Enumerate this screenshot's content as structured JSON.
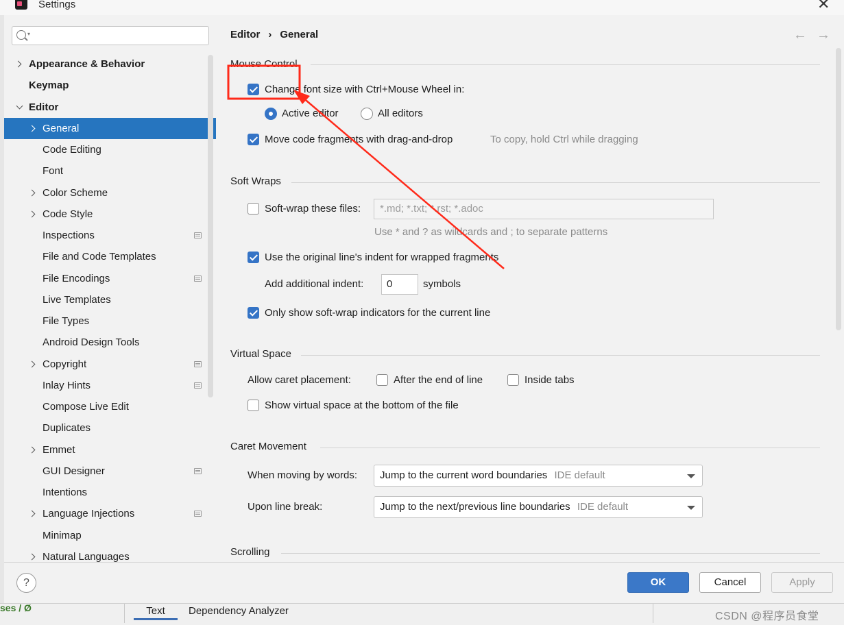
{
  "window": {
    "title": "Settings",
    "close_glyph": "✕"
  },
  "search": {
    "placeholder": ""
  },
  "sidebar": {
    "items": [
      {
        "label": "Appearance & Behavior",
        "bold": true,
        "expander": "right",
        "level": 0
      },
      {
        "label": "Keymap",
        "bold": true,
        "expander": "none",
        "level": 0
      },
      {
        "label": "Editor",
        "bold": true,
        "expander": "down",
        "level": 0
      },
      {
        "label": "General",
        "bold": false,
        "expander": "right",
        "level": 1,
        "selected": true
      },
      {
        "label": "Code Editing",
        "bold": false,
        "expander": "none",
        "level": 1
      },
      {
        "label": "Font",
        "bold": false,
        "expander": "none",
        "level": 1
      },
      {
        "label": "Color Scheme",
        "bold": false,
        "expander": "right",
        "level": 1
      },
      {
        "label": "Code Style",
        "bold": false,
        "expander": "right",
        "level": 1
      },
      {
        "label": "Inspections",
        "bold": false,
        "expander": "none",
        "level": 1,
        "project_icon": true
      },
      {
        "label": "File and Code Templates",
        "bold": false,
        "expander": "none",
        "level": 1
      },
      {
        "label": "File Encodings",
        "bold": false,
        "expander": "none",
        "level": 1,
        "project_icon": true
      },
      {
        "label": "Live Templates",
        "bold": false,
        "expander": "none",
        "level": 1
      },
      {
        "label": "File Types",
        "bold": false,
        "expander": "none",
        "level": 1
      },
      {
        "label": "Android Design Tools",
        "bold": false,
        "expander": "none",
        "level": 1
      },
      {
        "label": "Copyright",
        "bold": false,
        "expander": "right",
        "level": 1,
        "project_icon": true
      },
      {
        "label": "Inlay Hints",
        "bold": false,
        "expander": "none",
        "level": 1,
        "project_icon": true
      },
      {
        "label": "Compose Live Edit",
        "bold": false,
        "expander": "none",
        "level": 1
      },
      {
        "label": "Duplicates",
        "bold": false,
        "expander": "none",
        "level": 1
      },
      {
        "label": "Emmet",
        "bold": false,
        "expander": "right",
        "level": 1
      },
      {
        "label": "GUI Designer",
        "bold": false,
        "expander": "none",
        "level": 1,
        "project_icon": true
      },
      {
        "label": "Intentions",
        "bold": false,
        "expander": "none",
        "level": 1
      },
      {
        "label": "Language Injections",
        "bold": false,
        "expander": "right",
        "level": 1,
        "project_icon": true
      },
      {
        "label": "Minimap",
        "bold": false,
        "expander": "none",
        "level": 1
      },
      {
        "label": "Natural Languages",
        "bold": false,
        "expander": "right",
        "level": 1
      }
    ]
  },
  "breadcrumb": {
    "parent": "Editor",
    "separator": "›",
    "current": "General"
  },
  "nav": {
    "back": "←",
    "forward": "→"
  },
  "mouse_control": {
    "title": "Mouse Control",
    "change_font_size": {
      "label": "Change font size with Ctrl+Mouse Wheel in:",
      "checked": true
    },
    "active_editor": {
      "label": "Active editor",
      "selected": true
    },
    "all_editors": {
      "label": "All editors",
      "selected": false
    },
    "move_fragments": {
      "label": "Move code fragments with drag-and-drop",
      "checked": true,
      "hint": "To copy, hold Ctrl while dragging"
    }
  },
  "soft_wraps": {
    "title": "Soft Wraps",
    "soft_wrap_files": {
      "label": "Soft-wrap these files:",
      "checked": false,
      "value": "*.md; *.txt; *.rst; *.adoc"
    },
    "patterns_hint": "Use * and ? as wildcards and ; to separate patterns",
    "original_indent": {
      "label": "Use the original line's indent for wrapped fragments",
      "checked": true
    },
    "additional_indent": {
      "label": "Add additional indent:",
      "value": "0",
      "suffix": "symbols"
    },
    "only_current_line": {
      "label": "Only show soft-wrap indicators for the current line",
      "checked": true
    }
  },
  "virtual_space": {
    "title": "Virtual Space",
    "allow_caret": "Allow caret placement:",
    "after_end": {
      "label": "After the end of line",
      "checked": false
    },
    "inside_tabs": {
      "label": "Inside tabs",
      "checked": false
    },
    "show_bottom": {
      "label": "Show virtual space at the bottom of the file",
      "checked": false
    }
  },
  "caret_movement": {
    "title": "Caret Movement",
    "moving_by_words": {
      "label": "When moving by words:",
      "value": "Jump to the current word boundaries",
      "tag": "IDE default"
    },
    "line_break": {
      "label": "Upon line break:",
      "value": "Jump to the next/previous line boundaries",
      "tag": "IDE default"
    }
  },
  "scrolling": {
    "title": "Scrolling"
  },
  "buttons": {
    "help": "?",
    "ok": "OK",
    "cancel": "Cancel",
    "apply": "Apply"
  },
  "footer": {
    "project_text": "ses / Ø",
    "tab_text": "Text",
    "tab_dependency": "Dependency Analyzer",
    "watermark": "CSDN @程序员食堂"
  },
  "colors": {
    "selection": "#2675bf",
    "checkbox_on": "#3574c6",
    "ok_button": "#3b78c8",
    "annotation": "#ff2a1a"
  }
}
